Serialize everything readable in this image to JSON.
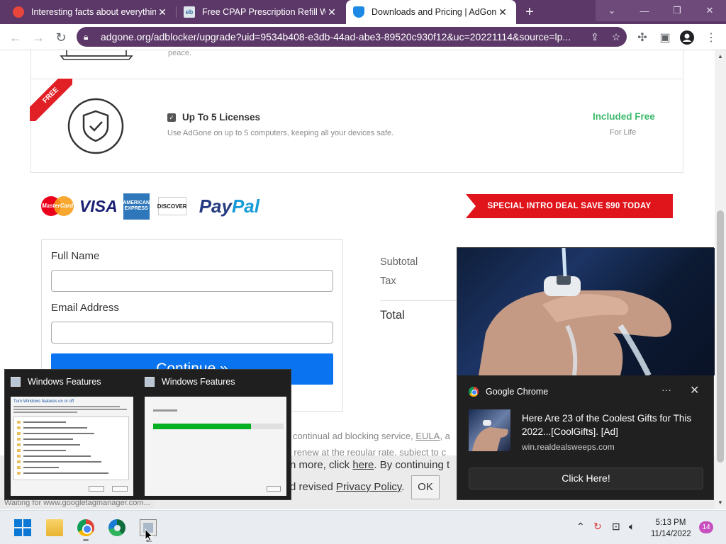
{
  "browser": {
    "tabs": [
      {
        "title": "Interesting facts about everything"
      },
      {
        "title": "Free CPAP Prescription Refill With"
      },
      {
        "title": "Downloads and Pricing | AdGone"
      }
    ],
    "url": "adgone.org/adblocker/upgrade?uid=9534b408-e3db-44ad-abe3-89520c930f12&uc=20221114&source=lp...",
    "theme_color": "#5c3868"
  },
  "page": {
    "top_feature_desc": "peace.",
    "ribbon": "FREE",
    "license_title": "Up To 5 Licenses",
    "license_desc": "Use AdGone on up to 5 computers, keeping all your devices safe.",
    "included": "Included Free",
    "for_life": "For Life",
    "payment_logos": {
      "mastercard": "MasterCard",
      "visa": "VISA",
      "amex": "AMERICAN EXPRESS",
      "discover": "DISCOVER",
      "paypal_a": "Pay",
      "paypal_b": "Pal"
    },
    "deal_banner": "SPECIAL INTRO DEAL SAVE $90 TODAY",
    "form": {
      "name_label": "Full Name",
      "email_label": "Email Address",
      "continue": "Continue »"
    },
    "summary": {
      "subtotal": "Subtotal",
      "tax": "Tax",
      "total": "Total"
    },
    "policy": {
      "l1_pre": "r continual ad blocking service, ",
      "l1_link": "EULA",
      "l1_post": ", a",
      "l2_pre": "ll renew at the ",
      "l2_link": "regular rate",
      "l2_post": ", subject to c"
    },
    "cookie": {
      "l1_pre": "n more, click ",
      "l1_link": "here",
      "l1_post": ". By continuing t",
      "l2_pre": "d revised ",
      "l2_link": "Privacy Policy",
      "l2_post": ".",
      "ok": "OK"
    },
    "status": "Waiting for www.googletagmanager.com..."
  },
  "thumbnails": {
    "win1_title": "Windows Features",
    "win2_title": "Windows Features",
    "win1_heading": "Turn Windows features on or off",
    "progress_fraction": 0.75,
    "progress_color": "#06b025"
  },
  "notification": {
    "app": "Google Chrome",
    "title": "Here Are 23 of the Coolest Gifts for This 2022...[CoolGifts].    [Ad]",
    "source": "win.realdealsweeps.com",
    "cta": "Click Here!"
  },
  "taskbar": {
    "time": "5:13 PM",
    "date": "11/14/2022",
    "badge": "14"
  }
}
